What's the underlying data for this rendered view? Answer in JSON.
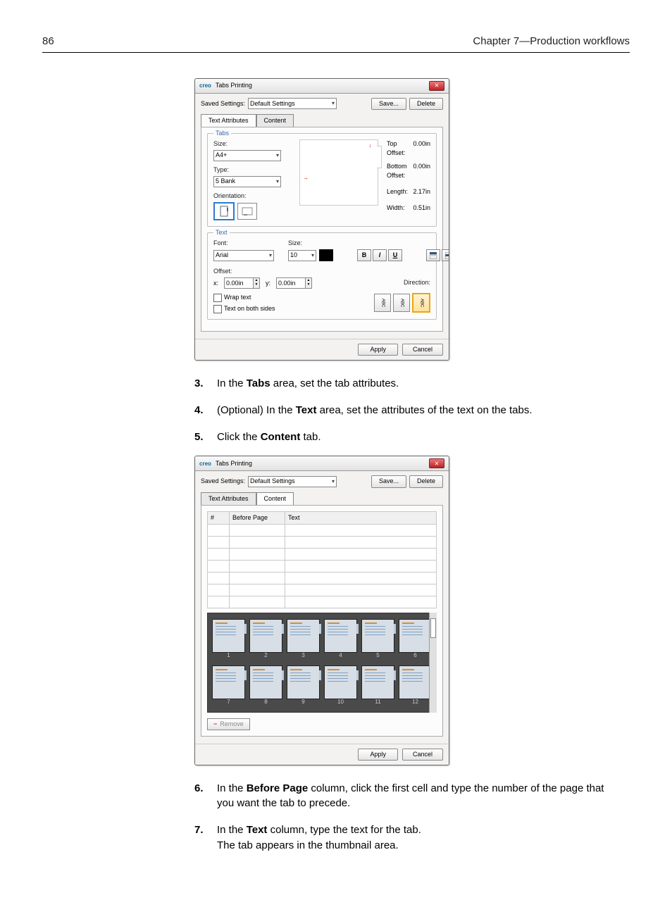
{
  "page_header": {
    "number": "86",
    "chapter": "Chapter 7—Production workflows"
  },
  "shot1": {
    "window_title": "Tabs Printing",
    "saved_settings_label": "Saved Settings:",
    "saved_settings_value": "Default Settings",
    "save_btn": "Save...",
    "delete_btn": "Delete",
    "tab_text_attributes": "Text Attributes",
    "tab_content": "Content",
    "group_tabs": "Tabs",
    "size_label": "Size:",
    "size_value": "A4+",
    "type_label": "Type:",
    "type_value": "5 Bank",
    "orientation_label": "Orientation:",
    "measures": {
      "top_offset_label": "Top Offset:",
      "top_offset_val": "0.00in",
      "bottom_offset_label": "Bottom Offset:",
      "bottom_offset_val": "0.00in",
      "length_label": "Length:",
      "length_val": "2.17in",
      "width_label": "Width:",
      "width_val": "0.51in"
    },
    "group_text": "Text",
    "font_label": "Font:",
    "font_value": "Arial",
    "font_size_label": "Size:",
    "font_size_value": "10",
    "offset_label": "Offset:",
    "offset_x_lbl": "x:",
    "offset_x": "0.00in",
    "offset_y_lbl": "y:",
    "offset_y": "0.00in",
    "direction_label": "Direction:",
    "wrap_text": "Wrap text",
    "both_sides": "Text on both sides",
    "apply_btn": "Apply",
    "cancel_btn": "Cancel"
  },
  "steps_a": [
    {
      "n": "3.",
      "text_before": "In the ",
      "bold": "Tabs",
      "text_after": " area, set the tab attributes."
    },
    {
      "n": "4.",
      "text_before": "(Optional) In the ",
      "bold": "Text",
      "text_after": " area, set the attributes of the text on the tabs."
    },
    {
      "n": "5.",
      "text_before": "Click the ",
      "bold": "Content",
      "text_after": " tab."
    }
  ],
  "shot2": {
    "window_title": "Tabs Printing",
    "saved_settings_label": "Saved Settings:",
    "saved_settings_value": "Default Settings",
    "save_btn": "Save...",
    "delete_btn": "Delete",
    "tab_text_attributes": "Text Attributes",
    "tab_content": "Content",
    "col_hash": "#",
    "col_before": "Before Page",
    "col_text": "Text",
    "remove_btn": "Remove",
    "apply_btn": "Apply",
    "cancel_btn": "Cancel",
    "thumbs": [
      "1",
      "2",
      "3",
      "4",
      "5",
      "6",
      "7",
      "8",
      "9",
      "10",
      "11",
      "12"
    ]
  },
  "steps_b": [
    {
      "n": "6.",
      "text_before": "In the ",
      "bold": "Before Page",
      "text_after": " column, click the first cell and type the number of the page that you want the tab to precede."
    },
    {
      "n": "7.",
      "text_before": "In the ",
      "bold": "Text",
      "text_after": " column, type the text for the tab.",
      "extra": "The tab appears in the thumbnail area."
    }
  ]
}
